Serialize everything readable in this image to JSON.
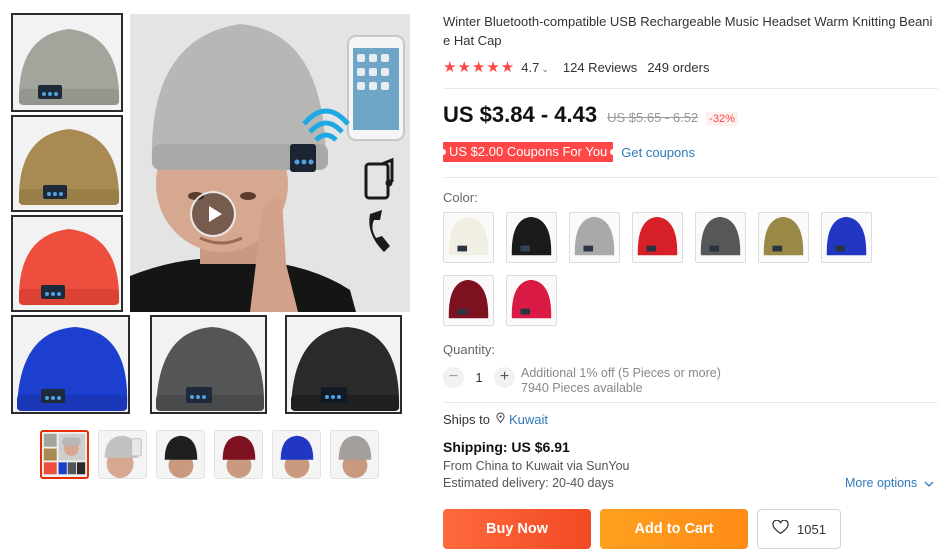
{
  "product": {
    "title": "Winter Bluetooth-compatible USB Rechargeable Music Headset Warm Knitting Beanie Hat Cap",
    "stars": "★★★★★",
    "rating": "4.7",
    "reviews": "124 Reviews",
    "orders": "249 orders"
  },
  "price": {
    "current": "US $3.84 - 4.43",
    "original": "US $5.65 - 6.52",
    "discount": "-32%"
  },
  "coupon": {
    "label": "US $2.00 Coupons For You",
    "link": "Get coupons"
  },
  "color": {
    "label": "Color:",
    "options": [
      {
        "name": "cream",
        "hex": "#f1efe3"
      },
      {
        "name": "black",
        "hex": "#1b1b1b"
      },
      {
        "name": "light-gray",
        "hex": "#a9a9a9"
      },
      {
        "name": "red",
        "hex": "#d71f27"
      },
      {
        "name": "dark-gray",
        "hex": "#555759"
      },
      {
        "name": "khaki",
        "hex": "#9a8847"
      },
      {
        "name": "blue",
        "hex": "#2137c4"
      },
      {
        "name": "burgundy",
        "hex": "#7d1120"
      },
      {
        "name": "rose-red",
        "hex": "#d81a45"
      }
    ]
  },
  "quantity": {
    "label": "Quantity:",
    "value": "1",
    "minus": "−",
    "plus": "+",
    "offer": "Additional 1% off (5 Pieces or more)",
    "available": "7940 Pieces available"
  },
  "shipping": {
    "ships_to_label": "Ships to",
    "country": "Kuwait",
    "title": "Shipping: US $6.91",
    "from_prefix": "From ",
    "origin": "China",
    "to_text": " to ",
    "destination": "Kuwait",
    "via_text": " via ",
    "carrier": "SunYou",
    "delivery": "Estimated delivery: 20-40 days",
    "more_options": "More options"
  },
  "actions": {
    "buy_now": "Buy Now",
    "add_to_cart": "Add to Cart",
    "wishlist_count": "1051"
  },
  "colors": {
    "accent_red": "#ff4747",
    "link_blue": "#2f79b8",
    "buy_orange": "#f24923",
    "cart_orange": "#ff8b16"
  }
}
